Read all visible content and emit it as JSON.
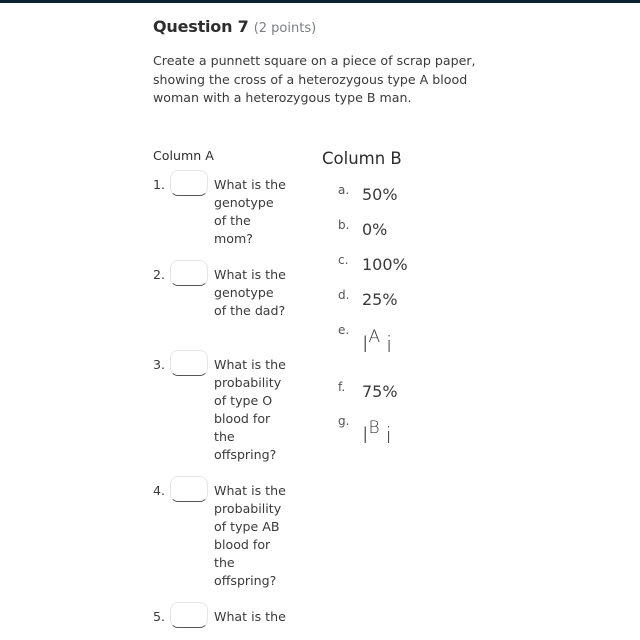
{
  "question": {
    "title": "Question 7",
    "points": "(2 points)",
    "prompt": "Create a punnett square on a piece of scrap paper, showing the cross of a heterozygous type A blood woman with a heterozygous type B man."
  },
  "column_a": {
    "heading": "Column A",
    "items": [
      {
        "number": "1.",
        "selected": "",
        "text": "What is the genotype of the mom?"
      },
      {
        "number": "2.",
        "selected": "",
        "text": "What is the genotype of the dad?"
      },
      {
        "number": "3.",
        "selected": "",
        "text": "What is the probability of type O blood for the offspring?"
      },
      {
        "number": "4.",
        "selected": "",
        "text": "What is the probability of type AB blood for the offspring?"
      },
      {
        "number": "5.",
        "selected": "",
        "text": "What is the"
      }
    ]
  },
  "column_b": {
    "heading": "Column B",
    "items": [
      {
        "letter": "a.",
        "value": "50%"
      },
      {
        "letter": "b.",
        "value": "0%"
      },
      {
        "letter": "c.",
        "value": "100%"
      },
      {
        "letter": "d.",
        "value": "25%"
      },
      {
        "letter": "e.",
        "base": "I",
        "sup": "A",
        "recessive": "i"
      },
      {
        "letter": "f.",
        "value": "75%"
      },
      {
        "letter": "g.",
        "base": "I",
        "sup": "B",
        "recessive": "i"
      }
    ]
  },
  "colors": {
    "top_bar": "#0b2231",
    "text": "#3a3a3a",
    "points_text": "#7a7f85"
  }
}
